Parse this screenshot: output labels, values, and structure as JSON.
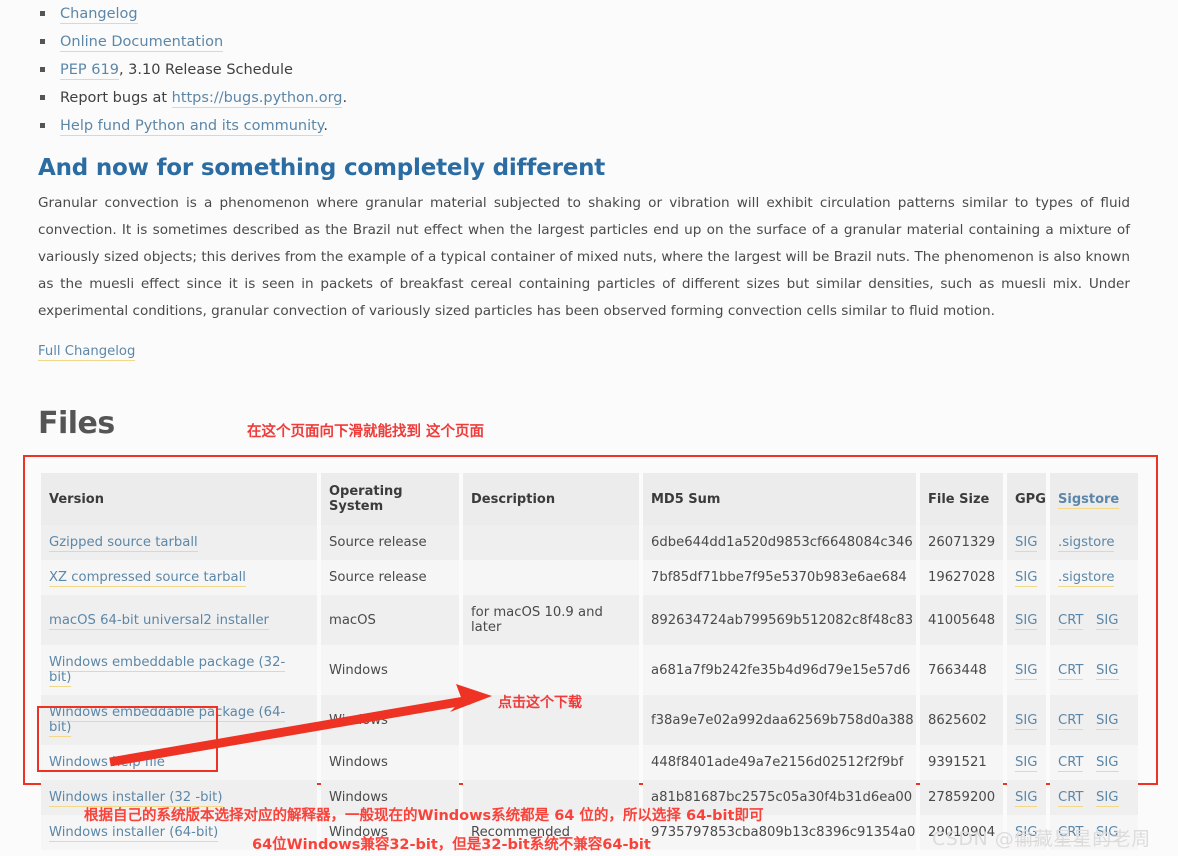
{
  "top_links": [
    {
      "link": "Changelog",
      "suffix": ""
    },
    {
      "link": "Online Documentation",
      "suffix": ""
    },
    {
      "link": "PEP 619",
      "suffix": ", 3.10 Release Schedule"
    },
    {
      "prefix": "Report bugs at ",
      "link": "https://bugs.python.org",
      "suffix": "."
    },
    {
      "link": "Help fund Python and its community",
      "suffix": "."
    }
  ],
  "section": {
    "heading": "And now for something completely different",
    "paragraph": "Granular convection is a phenomenon where granular material subjected to shaking or vibration will exhibit circulation patterns similar to types of fluid convection. It is sometimes described as the Brazil nut effect when the largest particles end up on the surface of a granular material containing a mixture of variously sized objects; this derives from the example of a typical container of mixed nuts, where the largest will be Brazil nuts. The phenomenon is also known as the muesli effect since it is seen in packets of breakfast cereal containing particles of different sizes but similar densities, such as muesli mix. Under experimental conditions, granular convection of variously sized particles has been observed forming convection cells similar to fluid motion.",
    "full_changelog_link": "Full Changelog"
  },
  "files": {
    "heading": "Files",
    "columns": [
      "Version",
      "Operating System",
      "Description",
      "MD5 Sum",
      "File Size",
      "GPG",
      "Sigstore"
    ],
    "rows": [
      {
        "version": "Gzipped source tarball",
        "os": "Source release",
        "description": "",
        "md5": "6dbe644dd1a520d9853cf6648084c346",
        "size": "26071329",
        "gpg": "SIG",
        "crt": "",
        "sigstore": ".sigstore"
      },
      {
        "version": "XZ compressed source tarball",
        "os": "Source release",
        "description": "",
        "md5": "7bf85df71bbe7f95e5370b983e6ae684",
        "size": "19627028",
        "gpg": "SIG",
        "crt": "",
        "sigstore": ".sigstore"
      },
      {
        "version": "macOS 64-bit universal2 installer",
        "os": "macOS",
        "description": "for macOS 10.9 and later",
        "md5": "892634724ab799569b512082c8f48c83",
        "size": "41005648",
        "gpg": "SIG",
        "crt": "CRT",
        "sigstore": "SIG"
      },
      {
        "version": "Windows embeddable package (32-bit)",
        "os": "Windows",
        "description": "",
        "md5": "a681a7f9b242fe35b4d96d79e15e57d6",
        "size": "7663448",
        "gpg": "SIG",
        "crt": "CRT",
        "sigstore": "SIG"
      },
      {
        "version": "Windows embeddable package (64-bit)",
        "os": "Windows",
        "description": "",
        "md5": "f38a9e7e02a992daa62569b758d0a388",
        "size": "8625602",
        "gpg": "SIG",
        "crt": "CRT",
        "sigstore": "SIG"
      },
      {
        "version": "Windows help file",
        "os": "Windows",
        "description": "",
        "md5": "448f8401ade49a7e2156d02512f2f9bf",
        "size": "9391521",
        "gpg": "SIG",
        "crt": "CRT",
        "sigstore": "SIG"
      },
      {
        "version": "Windows installer (32 -bit)",
        "os": "Windows",
        "description": "",
        "md5": "a81b81687bc2575c05a30f4b31d6ea00",
        "size": "27859200",
        "gpg": "SIG",
        "crt": "CRT",
        "sigstore": "SIG"
      },
      {
        "version": "Windows installer (64-bit)",
        "os": "Windows",
        "description": "Recommended",
        "md5": "9735797853cba809b13c8396c91354a0",
        "size": "29010904",
        "gpg": "SIG",
        "crt": "CRT",
        "sigstore": "SIG"
      }
    ]
  },
  "annotations": {
    "top_note": "在这个页面向下滑就能找到 这个页面",
    "arrow_note": "点击这个下载",
    "bottom_note_1": "根据自己的系统版本选择对应的解释器，一般现在的Windows系统都是 64 位的，所以选择 64-bit即可",
    "bottom_note_2": "64位Windows兼容32-bit，但是32-bit系统不兼容64-bit",
    "watermark": "CSDN @偷藏星星的老周"
  },
  "colors": {
    "annotation_red": "#ef3b39",
    "link_blue": "#5c87a8",
    "heading_blue": "#2b6ca3",
    "link_underline": "#f2d98a"
  }
}
